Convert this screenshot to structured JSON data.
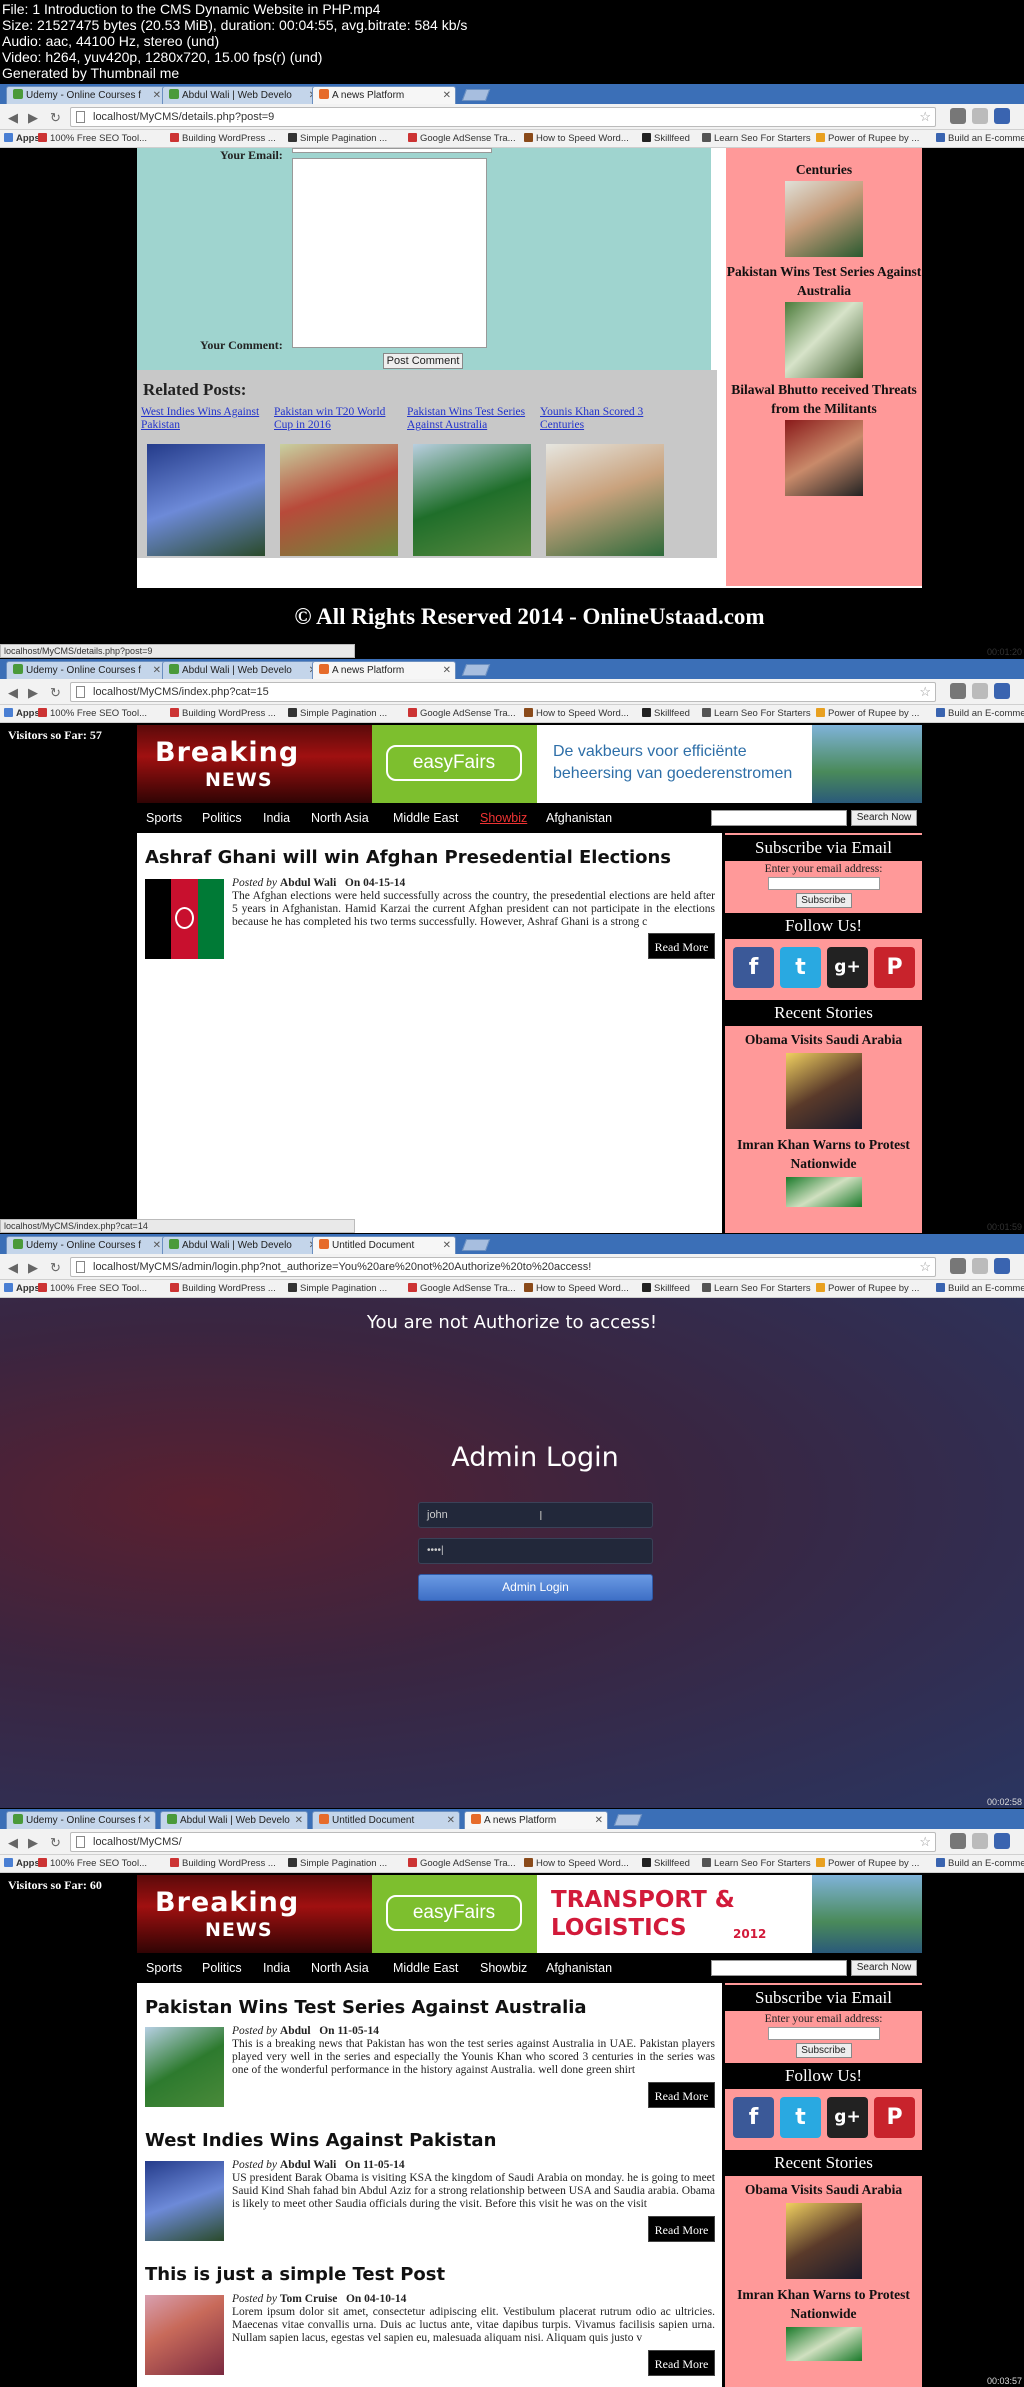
{
  "video_header": {
    "lines": [
      "File: 1 Introduction to the CMS Dynamic Website in PHP.mp4",
      "Size: 21527475 bytes (20.53 MiB), duration: 00:04:55, avg.bitrate: 584 kb/s",
      "Audio: aac, 44100 Hz, stereo (und)",
      "Video: h264, yuv420p, 1280x720, 15.00 fps(r) (und)",
      "Generated by Thumbnail me"
    ]
  },
  "browser": {
    "tab_udemy": "Udemy - Online Courses f",
    "tab_abdul": "Abdul Wali | Web Develo",
    "tab_news": "A news Platform",
    "tab_untitled": "Untitled Document",
    "bookmarks": [
      "Apps",
      "100% Free SEO Tool...",
      "Building WordPress ...",
      "Simple Pagination ...",
      "Google AdSense Tra...",
      "How to Speed Word...",
      "Skillfeed",
      "Learn Seo For Starters",
      "Power of Rupee by ...",
      "Build an E-comme"
    ]
  },
  "frames": [
    {
      "url": "localhost/MyCMS/details.php?post=9",
      "status": "localhost/MyCMS/details.php?post=9",
      "timestamp": "00:01:20",
      "form": {
        "email_label": "Your Email:",
        "comment_label": "Your Comment:",
        "button": "Post Comment"
      },
      "related_heading": "Related Posts:",
      "related": [
        "West Indies Wins Against Pakistan",
        "Pakistan win T20 World Cup in 2016",
        "Pakistan Wins Test Series Against Australia",
        "Younis Khan Scored 3 Centuries"
      ],
      "sidebar_items": [
        "Centuries",
        "Pakistan Wins Test Series Against Australia",
        "Bilawal Bhutto received Threats from the Militants"
      ],
      "footer": "© All Rights Reserved 2014 - OnlineUstaad.com"
    },
    {
      "url": "localhost/MyCMS/index.php?cat=15",
      "status": "localhost/MyCMS/index.php?cat=14",
      "timestamp": "00:01:59",
      "visitors": "Visitors so Far: 57",
      "banner_logo_top": "Breaking",
      "banner_logo_bottom": "NEWS",
      "ad_brand": "easyFairs",
      "ad_text": "De vakbeurs voor efficiënte beheersing van goederenstromen",
      "menu": [
        "Sports",
        "Politics",
        "India",
        "North Asia",
        "Middle East",
        "Showbiz",
        "Afghanistan"
      ],
      "search_button": "Search Now",
      "posts": [
        {
          "title": "Ashraf Ghani will win Afghan Presedential Elections",
          "posted_by": "Posted by",
          "author": "Abdul Wali",
          "on": "On",
          "date": "04-15-14",
          "excerpt": "The Afghan elections were held successfully across the country, the presedential elections are held after 5 years in Afghanistan. Hamid Karzai the current Afghan president can not participate in the elections because he has completed his two terms successfully. However, Ashraf Ghani is a strong c",
          "read_more": "Read More"
        }
      ],
      "subscribe": {
        "heading": "Subscribe via Email",
        "label": "Enter your email address:",
        "button": "Subscribe"
      },
      "follow_heading": "Follow Us!",
      "recent_heading": "Recent Stories",
      "recent": [
        "Obama Visits Saudi Arabia",
        "Imran Khan Warns to Protest Nationwide"
      ]
    },
    {
      "url": "localhost/MyCMS/admin/login.php?not_authorize=You%20are%20not%20Authorize%20to%20access!",
      "timestamp": "00:02:58",
      "not_authorized": "You are not Authorize to access!",
      "heading": "Admin Login",
      "username_value": "john",
      "password_value": "••••|",
      "button": "Admin Login"
    },
    {
      "url": "localhost/MyCMS/",
      "timestamp": "00:03:57",
      "visitors": "Visitors so Far: 60",
      "banner_logo_top": "Breaking",
      "banner_logo_bottom": "NEWS",
      "ad_brand": "easyFairs",
      "ad_text_line1": "TRANSPORT &",
      "ad_text_line2": "LOGISTICS",
      "ad_year": "2012",
      "menu": [
        "Sports",
        "Politics",
        "India",
        "North Asia",
        "Middle East",
        "Showbiz",
        "Afghanistan"
      ],
      "search_button": "Search Now",
      "posts": [
        {
          "title": "Pakistan Wins Test Series Against Australia",
          "posted_by": "Posted by",
          "author": "Abdul",
          "on": "On",
          "date": "11-05-14",
          "excerpt": "This is a breaking news that Pakistan has won the test series against Australia in UAE. Pakistan players played very well in the series and especially the Younis Khan who scored 3 centuries in the series was one of the wonderful performance in the history against Australia. well done green shirt",
          "read_more": "Read More"
        },
        {
          "title": "West Indies Wins Against Pakistan",
          "posted_by": "Posted by",
          "author": "Abdul Wali",
          "on": "On",
          "date": "11-05-14",
          "excerpt": "US president Barak Obama is visiting KSA the kingdom of Saudi Arabia on monday. he is going to meet Sauid Kind Shah fahad bin Abdul Aziz for a strong relationship between USA and Saudia arabia. Obama is likely to meet other Saudia officials during the visit. Before this visit he was on the visit",
          "read_more": "Read More"
        },
        {
          "title": "This is just a simple Test Post",
          "posted_by": "Posted by",
          "author": "Tom Cruise",
          "on": "On",
          "date": "04-10-14",
          "excerpt": "Lorem ipsum dolor sit amet, consectetur adipiscing elit. Vestibulum placerat rutrum odio ac ultricies. Maecenas vitae convallis urna. Duis ac luctus ante, vitae dapibus turpis. Vivamus facilisis sapien urna. Nullam sapien lacus, egestas vel sapien eu, malesuada aliquam nisi. Aliquam quis justo v",
          "read_more": "Read More"
        }
      ],
      "subscribe": {
        "heading": "Subscribe via Email",
        "label": "Enter your email address:",
        "button": "Subscribe"
      },
      "follow_heading": "Follow Us!",
      "recent_heading": "Recent Stories",
      "recent": [
        "Obama Visits Saudi Arabia",
        "Imran Khan Warns to Protest Nationwide"
      ]
    }
  ],
  "colors": {
    "sidebar_pink": "#ff9999",
    "form_teal": "#9fd4cf",
    "tab_strip_blue": "#3b6fb7",
    "login_button": "#4a7fd3"
  }
}
